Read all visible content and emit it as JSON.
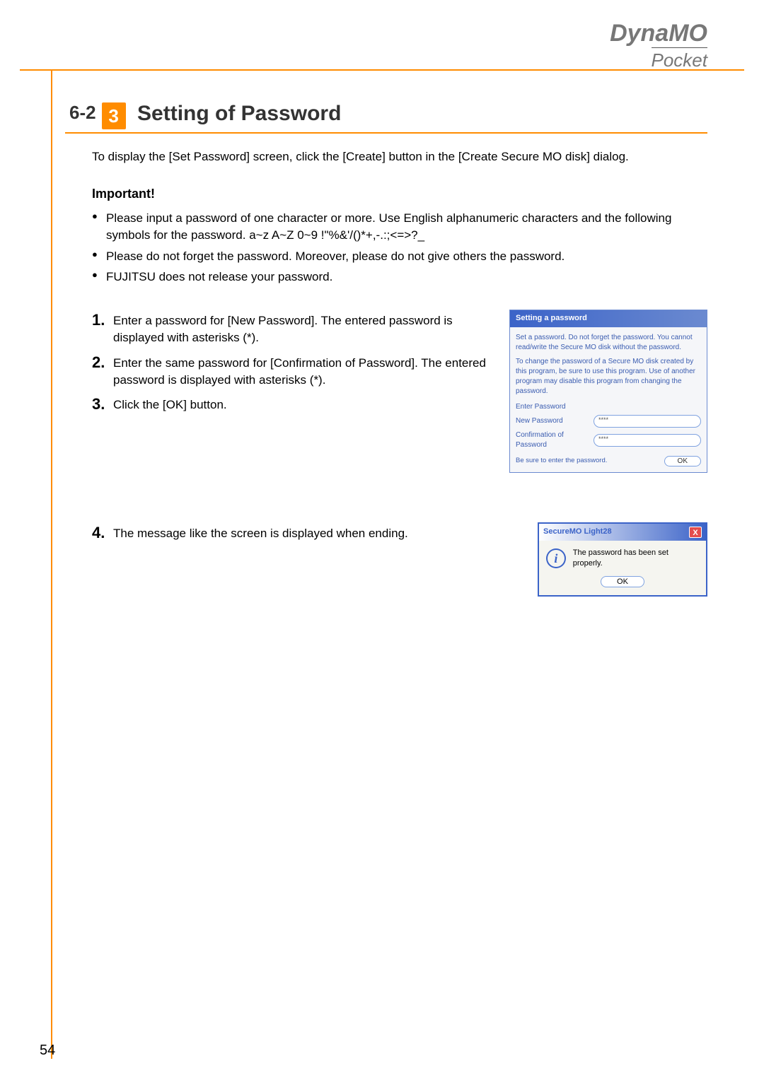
{
  "header": {
    "brand_line1": "DynaMO",
    "brand_line2": "Pocket"
  },
  "section": {
    "badge_prefix": "6-2",
    "badge_num": "3",
    "title": "Setting of Password"
  },
  "intro": "To display the [Set Password] screen, click the [Create] button in the [Create Secure MO disk] dialog.",
  "important": {
    "label": "Important!",
    "bullets": [
      "Please input a password of one character or more. Use English alphanumeric characters and the following symbols for the password. a~z A~Z 0~9 !\"%&'/()*+,-.:;<=>?_",
      "Please do not forget the password. Moreover, please do not give others the password.",
      "FUJITSU does not release your password."
    ]
  },
  "steps": [
    {
      "num": "1.",
      "text": "Enter a password for [New Password]. The entered password is displayed with asterisks (*)."
    },
    {
      "num": "2.",
      "text": "Enter the same password for [Confirmation of Password]. The entered password is displayed with asterisks (*)."
    },
    {
      "num": "3.",
      "text": "Click the [OK] button."
    },
    {
      "num": "4.",
      "text": "The message like the screen is displayed when ending."
    }
  ],
  "dialog1": {
    "title": "Setting a password",
    "para1": "Set a password. Do not forget the password. You cannot read/write the Secure MO disk without the password.",
    "para2": "To change the password of a Secure MO disk created by this program, be sure to use this program. Use of another program may disable this program from changing the password.",
    "fieldset_label": "Enter Password",
    "field_new": "New Password",
    "field_confirm": "Confirmation of Password",
    "value_mask": "****",
    "note": "Be sure to enter the password.",
    "ok": "OK"
  },
  "dialog2": {
    "title": "SecureMO Light28",
    "message": "The password has been set properly.",
    "ok": "OK",
    "close": "X"
  },
  "page_number": "54"
}
